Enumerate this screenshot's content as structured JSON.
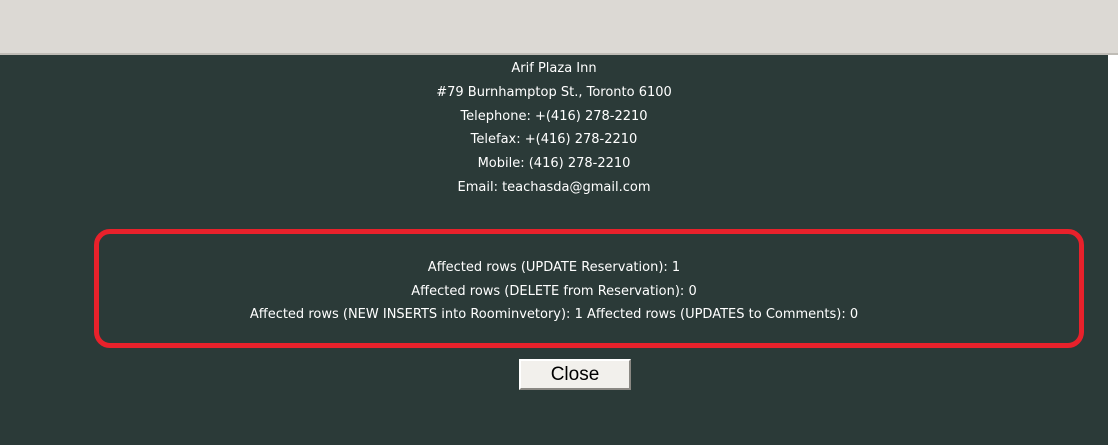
{
  "hotel": {
    "name": "Arif Plaza Inn",
    "address": "#79 Burnhamptop St., Toronto 6100",
    "telephone": "Telephone:  +(416) 278-2210",
    "telefax": "Telefax:  +(416) 278-2210",
    "mobile": "Mobile: (416) 278-2210",
    "email": "Email: teachasda@gmail.com"
  },
  "results": {
    "update_reservation": "Affected rows (UPDATE Reservation): 1",
    "delete_reservation": "Affected rows (DELETE from Reservation): 0",
    "inserts_and_comments": "Affected rows (NEW INSERTS into Roominvetory): 1 Affected rows (UPDATES to Comments): 0"
  },
  "actions": {
    "close_label": "Close"
  },
  "colors": {
    "panel_background": "#2b3a38",
    "top_bar": "#dcd9d4",
    "highlight_border": "#e8212b",
    "text": "#ffffff"
  }
}
